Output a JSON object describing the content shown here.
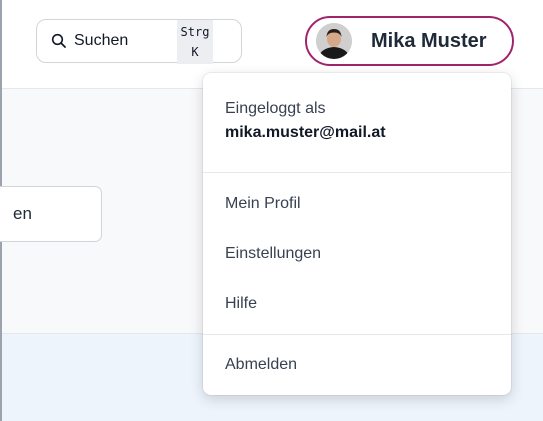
{
  "search": {
    "label": "Suchen",
    "shortcut_line1": "Strg",
    "shortcut_line2": "K",
    "icon": "search-icon"
  },
  "user": {
    "name": "Mika Muster",
    "accent_color": "#a0246c"
  },
  "section_button": {
    "label_fragment": "en"
  },
  "user_menu": {
    "logged_in_label": "Eingeloggt als",
    "email": "mika.muster@mail.at",
    "items": [
      {
        "label": "Mein Profil"
      },
      {
        "label": "Einstellungen"
      },
      {
        "label": "Hilfe"
      }
    ],
    "logout_label": "Abmelden"
  }
}
